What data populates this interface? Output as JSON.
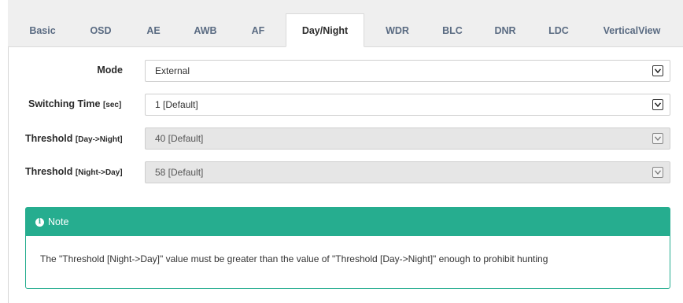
{
  "tabs": [
    {
      "label": "Basic"
    },
    {
      "label": "OSD"
    },
    {
      "label": "AE"
    },
    {
      "label": "AWB"
    },
    {
      "label": "AF"
    },
    {
      "label": "Day/Night"
    },
    {
      "label": "WDR"
    },
    {
      "label": "BLC"
    },
    {
      "label": "DNR"
    },
    {
      "label": "LDC"
    },
    {
      "label": "VerticalView"
    }
  ],
  "active_tab": "Day/Night",
  "form": {
    "mode": {
      "label": "Mode",
      "value": "External",
      "disabled": false
    },
    "switching_time": {
      "label": "Switching Time",
      "unit": "[sec]",
      "value": "1  [Default]",
      "disabled": false
    },
    "threshold_day_night": {
      "label": "Threshold",
      "unit": "[Day->Night]",
      "value": "40 [Default]",
      "disabled": true
    },
    "threshold_night_day": {
      "label": "Threshold",
      "unit": "[Night->Day]",
      "value": "58 [Default]",
      "disabled": true
    }
  },
  "note": {
    "icon": "info-circle-icon",
    "title": "Note",
    "text": "The \"Threshold [Night->Day]\" value must be greater than the value of \"Threshold [Day->Night]\" enough to prohibit hunting"
  },
  "colors": {
    "accent": "#26ad8f",
    "tabbar_bg": "#efefef",
    "tab_text": "#5a6b82",
    "disabled_field": "#e6e6e6"
  }
}
